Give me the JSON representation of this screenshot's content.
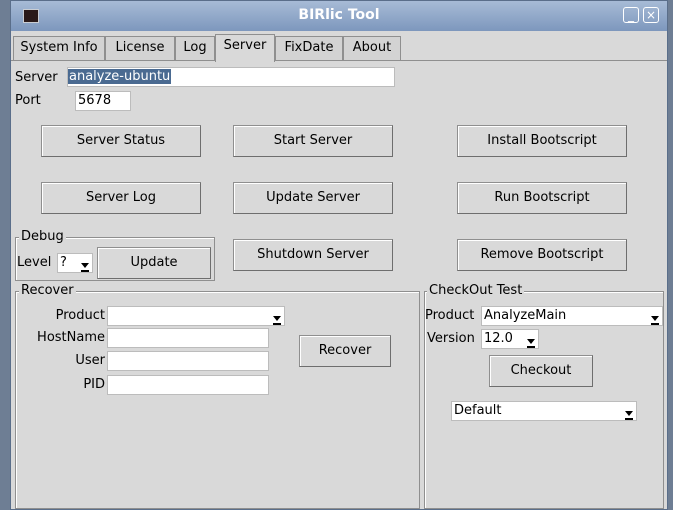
{
  "window": {
    "title": "BIRlic Tool",
    "minimize_glyph": "_",
    "close_glyph": "×"
  },
  "tabs": [
    {
      "label": "System Info"
    },
    {
      "label": "License"
    },
    {
      "label": "Log"
    },
    {
      "label": "Server",
      "active": true
    },
    {
      "label": "FixDate"
    },
    {
      "label": "About"
    }
  ],
  "server": {
    "label": "Server",
    "value": "analyze-ubuntu"
  },
  "port": {
    "label": "Port",
    "value": "5678"
  },
  "buttons": {
    "server_status": "Server Status",
    "start_server": "Start Server",
    "install_bootscript": "Install Bootscript",
    "server_log": "Server Log",
    "update_server": "Update Server",
    "run_bootscript": "Run Bootscript",
    "shutdown_server": "Shutdown Server",
    "remove_bootscript": "Remove Bootscript"
  },
  "debug": {
    "title": "Debug",
    "level_label": "Level",
    "level_value": "?",
    "update_label": "Update"
  },
  "recover": {
    "title": "Recover",
    "product_label": "Product",
    "product_value": "",
    "hostname_label": "HostName",
    "hostname_value": "",
    "user_label": "User",
    "user_value": "",
    "pid_label": "PID",
    "pid_value": "",
    "button_label": "Recover"
  },
  "checkout": {
    "title": "CheckOut Test",
    "product_label": "Product",
    "product_value": "AnalyzeMain",
    "version_label": "Version",
    "version_value": "12.0",
    "button_label": "Checkout",
    "default_value": "Default"
  },
  "colors": {
    "titlebar": "#8ea6c9",
    "selection": "#4a6a91",
    "window_bg": "#d9d9d9"
  }
}
